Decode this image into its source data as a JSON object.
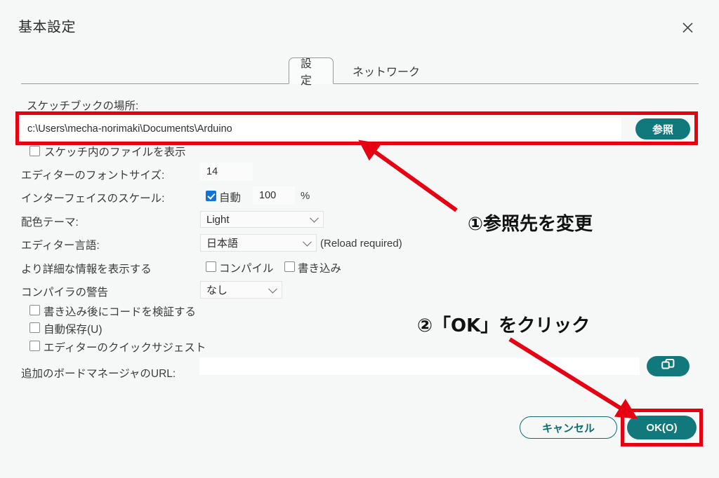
{
  "dialog": {
    "title": "基本設定",
    "close_icon": "close-icon"
  },
  "tabs": [
    {
      "label": "設定",
      "active": true
    },
    {
      "label": "ネットワーク",
      "active": false
    }
  ],
  "form": {
    "sketchbook": {
      "label": "スケッチブックの場所:",
      "value": "c:\\Users\\mecha-norimaki\\Documents\\Arduino",
      "browse_button": "参照"
    },
    "show_files_in_sketch": {
      "label": "スケッチ内のファイルを表示",
      "checked": false
    },
    "editor_font_size": {
      "label": "エディターのフォントサイズ:",
      "value": "14"
    },
    "interface_scale": {
      "label": "インターフェイスのスケール:",
      "auto_label": "自動",
      "auto_checked": true,
      "value": "100",
      "unit": "%"
    },
    "color_theme": {
      "label": "配色テーマ:",
      "value": "Light"
    },
    "editor_language": {
      "label": "エディター言語:",
      "value": "日本語",
      "note": "(Reload required)"
    },
    "verbose_output": {
      "label": "より詳細な情報を表示する",
      "compile_label": "コンパイル",
      "compile_checked": false,
      "upload_label": "書き込み",
      "upload_checked": false
    },
    "compiler_warnings": {
      "label": "コンパイラの警告",
      "value": "なし"
    },
    "verify_after_upload": {
      "label": "書き込み後にコードを検証する",
      "checked": false
    },
    "auto_save": {
      "label": "自動保存(U)",
      "checked": false
    },
    "quick_suggest": {
      "label": "エディターのクイックサジェスト",
      "checked": false
    },
    "board_manager_urls": {
      "label": "追加のボードマネージャのURL:",
      "value": "",
      "edit_button_icon": "windows-copy-icon"
    }
  },
  "footer": {
    "cancel_label": "キャンセル",
    "ok_label": "OK(O)"
  },
  "annotations": [
    {
      "text": "①参照先を変更"
    },
    {
      "text": "②「OK」をクリック"
    }
  ],
  "colors": {
    "accent_teal": "#11797b",
    "annotation_red": "#e60012",
    "checkbox_blue": "#1173d4"
  }
}
